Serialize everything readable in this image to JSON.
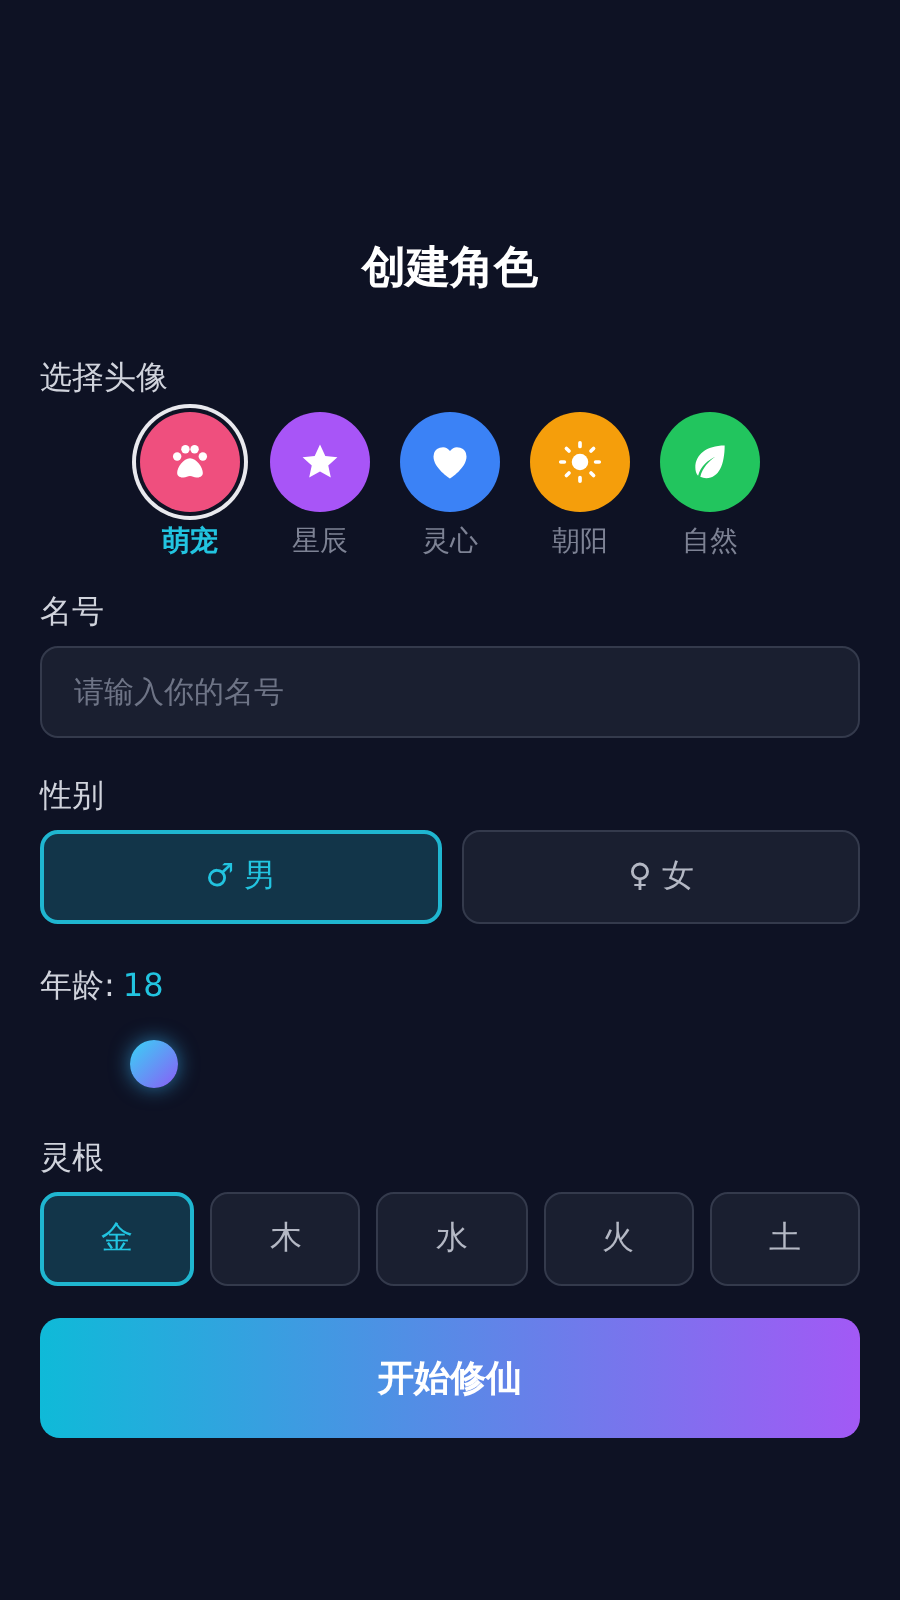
{
  "title": "创建角色",
  "avatar_section": {
    "label": "选择头像",
    "avatars": [
      {
        "kind": "paw",
        "name": "萌宠",
        "color": "#ef4f7e",
        "selected": true
      },
      {
        "kind": "star",
        "name": "星辰",
        "color": "#a855f7",
        "selected": false
      },
      {
        "kind": "heart",
        "name": "灵心",
        "color": "#3b82f6",
        "selected": false
      },
      {
        "kind": "sun",
        "name": "朝阳",
        "color": "#f59e0b",
        "selected": false
      },
      {
        "kind": "leaf",
        "name": "自然",
        "color": "#22c55e",
        "selected": false
      }
    ]
  },
  "name_section": {
    "label": "名号",
    "placeholder": "请输入你的名号"
  },
  "gender_section": {
    "label": "性别",
    "options": [
      {
        "symbol": "♂",
        "label": "男",
        "selected": true
      },
      {
        "symbol": "♀",
        "label": "女",
        "selected": false
      }
    ]
  },
  "age_section": {
    "label": "年龄:",
    "value": "18"
  },
  "root_section": {
    "label": "灵根",
    "options": [
      {
        "label": "金",
        "selected": true
      },
      {
        "label": "木",
        "selected": false
      },
      {
        "label": "水",
        "selected": false
      },
      {
        "label": "火",
        "selected": false
      },
      {
        "label": "土",
        "selected": false
      }
    ]
  },
  "start_button": "开始修仙"
}
